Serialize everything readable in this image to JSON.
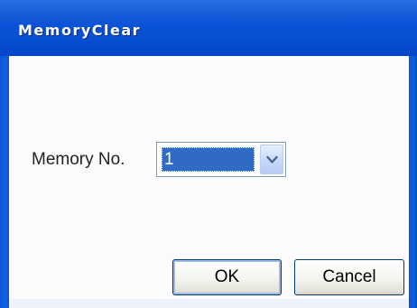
{
  "window": {
    "title": "MemoryClear"
  },
  "form": {
    "memory_label": "Memory No.",
    "memory_value": "1"
  },
  "buttons": {
    "ok_label": "OK",
    "cancel_label": "Cancel"
  },
  "icons": {
    "dropdown": "chevron-down-icon"
  },
  "colors": {
    "titlebar": "#0a52d6",
    "selection": "#316ac5",
    "button_border": "#003c74"
  }
}
